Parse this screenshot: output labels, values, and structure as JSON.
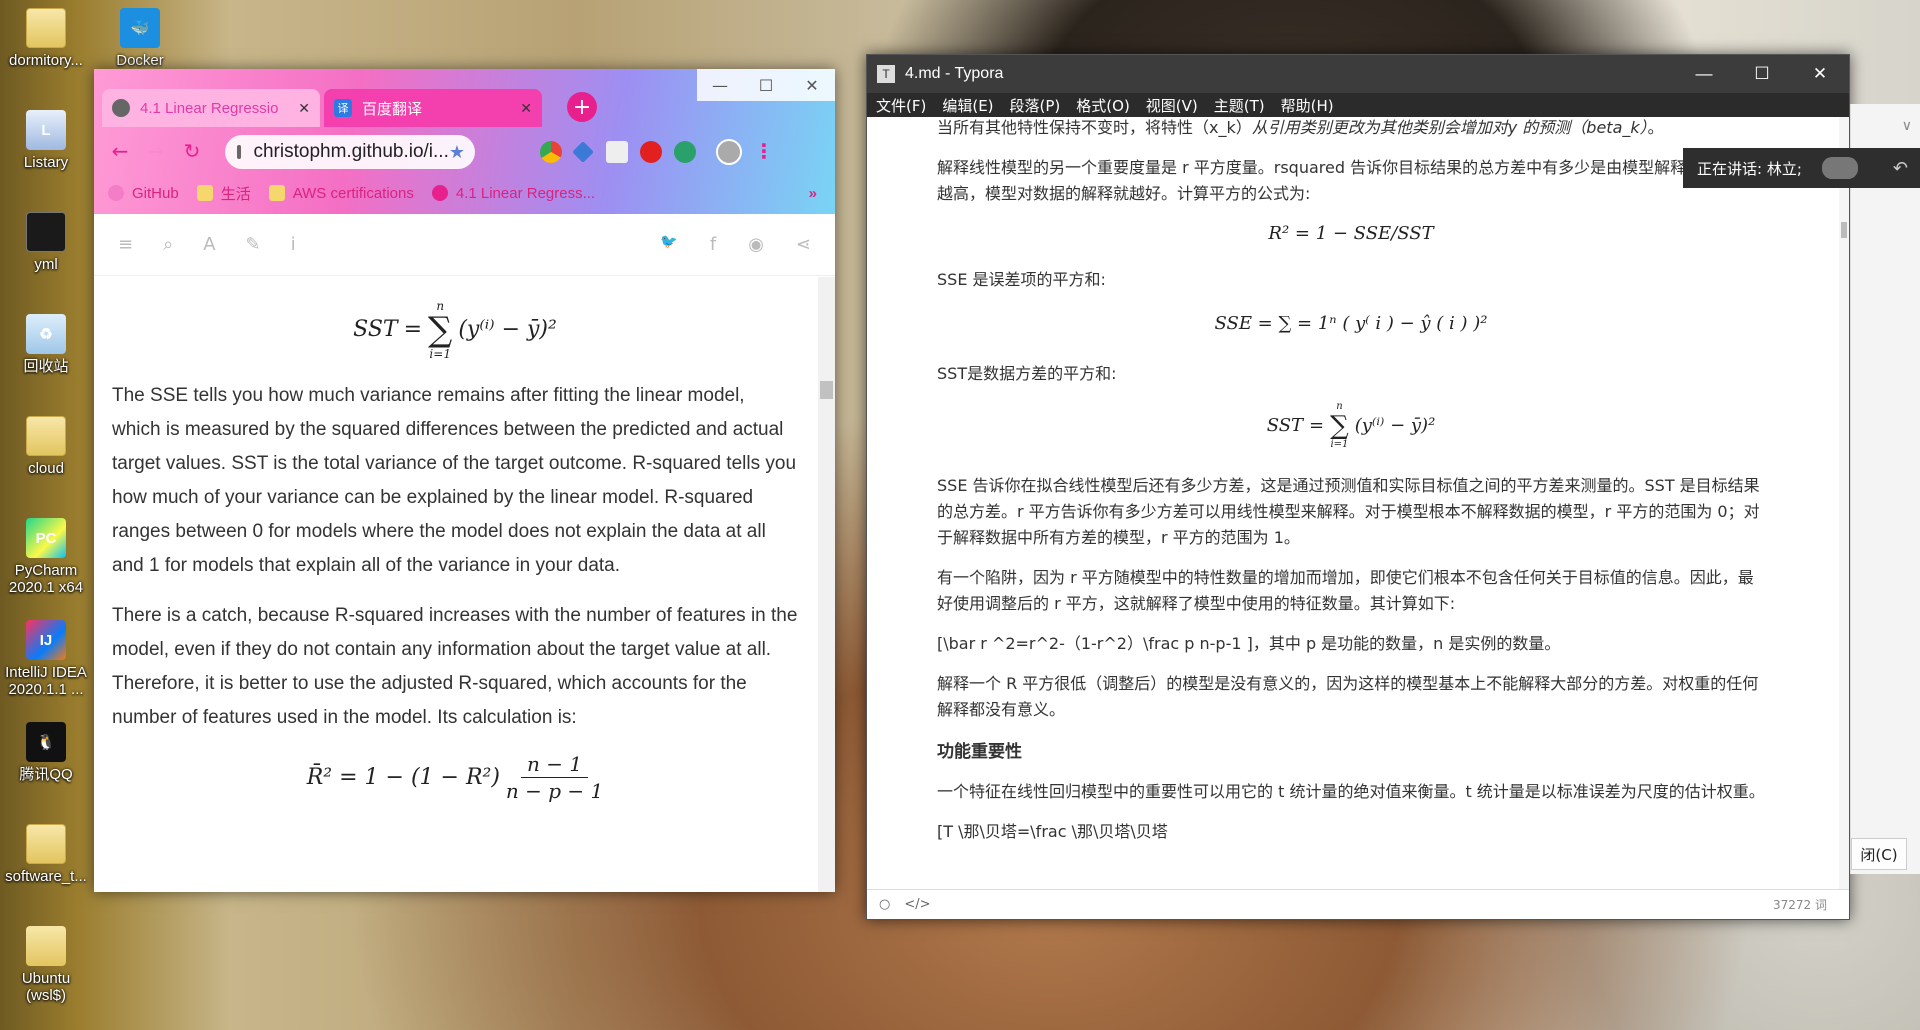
{
  "desktop": {
    "icons": [
      {
        "label": "dormitory...",
        "glyph": ""
      },
      {
        "label": "Docker",
        "glyph": "🐳"
      },
      {
        "label": "Listary",
        "glyph": "L"
      },
      {
        "label": "yml",
        "glyph": ""
      },
      {
        "label": "回收站",
        "glyph": "♻"
      },
      {
        "label": "cloud",
        "glyph": ""
      },
      {
        "label": "PyCharm 2020.1 x64",
        "glyph": "PC"
      },
      {
        "label": "IntelliJ IDEA 2020.1.1 ...",
        "glyph": "IJ"
      },
      {
        "label": "腾讯QQ",
        "glyph": "🐧"
      },
      {
        "label": "software_t...",
        "glyph": ""
      },
      {
        "label": "Ubuntu (wsl$)",
        "glyph": ""
      }
    ]
  },
  "chrome": {
    "tabs": [
      {
        "title": "4.1 Linear Regressio",
        "close": "✕"
      },
      {
        "title": "百度翻译",
        "close": "✕",
        "icon": "译"
      }
    ],
    "new_tab": "+",
    "window_controls": {
      "minimize": "—",
      "maximize": "☐",
      "close": "✕"
    },
    "nav": {
      "back": "←",
      "forward": "→",
      "reload": "↻",
      "menu": "⋮"
    },
    "url": "christophm.github.io/i...",
    "star": "★",
    "bookmarks": [
      "GitHub",
      "生活",
      "AWS certifications",
      "4.1 Linear Regress..."
    ],
    "bookmarks_more": "»",
    "reader_tools": {
      "menu": "≡",
      "search": "⌕",
      "font": "A",
      "edit": "✎",
      "info": "i"
    },
    "share_tools": {
      "twitter": "🐦",
      "facebook": "f",
      "github": "◉",
      "share": "⋖"
    },
    "content": {
      "eq1": {
        "lhs": "SST",
        "eq": "=",
        "upper": "n",
        "sigma": "∑",
        "lower": "i=1",
        "body": "(y⁽ⁱ⁾ − ȳ)²"
      },
      "para1": "The SSE tells you how much variance remains after fitting the linear model, which is measured by the squared differences between the predicted and actual target values. SST is the total variance of the target outcome. R-squared tells you how much of your variance can be explained by the linear model. R-squared ranges between 0 for models where the model does not explain the data at all and 1 for models that explain all of the variance in your data.",
      "para2": "There is a catch, because R-squared increases with the number of features in the model, even if they do not contain any information about the target value at all. Therefore, it is better to use the adjusted R-squared, which accounts for the number of features used in the model. Its calculation is:",
      "eq2": {
        "lhs": "R̄² = 1 − (1 − R²)",
        "num": "n − 1",
        "den": "n − p − 1"
      }
    }
  },
  "typora": {
    "title": "4.md - Typora",
    "icon": "T",
    "window_controls": {
      "minimize": "—",
      "maximize": "☐",
      "close": "✕"
    },
    "menu": [
      "文件(F)",
      "编辑(E)",
      "段落(P)",
      "格式(O)",
      "视图(V)",
      "主题(T)",
      "帮助(H)"
    ],
    "content": {
      "line0_a": "当所有其他特性保持不变时，将特性（x_k）",
      "line0_b": "从引用类别更改为其他类别会增加对y 的预测（beta_k）",
      "line0_c": "。",
      "p1": "解释线性模型的另一个重要度量是 r 平方度量。rsquared 告诉你目标结果的总方差中有多少是由模型解释的。r 平方越高，模型对数据的解释就越好。计算平方的公式为:",
      "eq_r2": "R² = 1 − SSE/SST",
      "p2": "SSE 是误差项的平方和:",
      "eq_sse": "SSE = ∑ = 1ⁿ ( y⁽ i ) − ŷ ( i ) )²",
      "eq_sse_sub": "i",
      "p3": "SST是数据方差的平方和:",
      "eq_sst": {
        "lhs": "SST",
        "eq": "=",
        "upper": "n",
        "sigma": "∑",
        "lower": "i=1",
        "body": "(y⁽ⁱ⁾ − ȳ)²"
      },
      "p4": "SSE 告诉你在拟合线性模型后还有多少方差，这是通过预测值和实际目标值之间的平方差来测量的。SST 是目标结果的总方差。r 平方告诉你有多少方差可以用线性模型来解释。对于模型根本不解释数据的模型，r 平方的范围为 0；对于解释数据中所有方差的模型，r 平方的范围为 1。",
      "p5": "有一个陷阱，因为 r 平方随模型中的特性数量的增加而增加，即使它们根本不包含任何关于目标值的信息。因此，最好使用调整后的 r 平方，这就解释了模型中使用的特征数量。其计算如下:",
      "p6": "[\\bar r ^2=r^2-（1-r^2）\\frac p n-p-1 ]，其中 p 是功能的数量，n 是实例的数量。",
      "p7": "解释一个 R 平方很低（调整后）的模型是没有意义的，因为这样的模型基本上不能解释大部分的方差。对权重的任何解释都没有意义。",
      "h1": "功能重要性",
      "p8": "一个特征在线性回归模型中的重要性可以用它的 t 统计量的绝对值来衡量。t 统计量是以标准误差为尺度的估计权重。",
      "p9": "[T \\那\\贝塔=\\frac \\那\\贝塔\\贝塔"
    },
    "status": {
      "outline": "○",
      "source": "</>",
      "word_count": "37272 词"
    }
  },
  "notification": {
    "text": "正在讲话: 林立;",
    "back": "↶"
  },
  "side_panel": {
    "chevron": "∨",
    "close_label": "闭(C)"
  }
}
